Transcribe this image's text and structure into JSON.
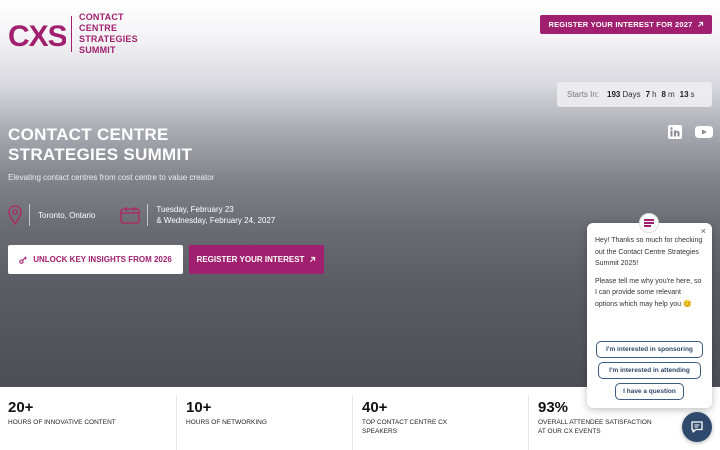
{
  "brand": {
    "logo_mark": "CXS",
    "logo_lines": [
      "CONTACT",
      "CENTRE",
      "STRATEGIES",
      "SUMMIT"
    ],
    "accent": "#a01f6e"
  },
  "header": {
    "cta_label": "REGISTER YOUR INTEREST FOR 2027",
    "cta_icon": "arrow-up-right-icon"
  },
  "countdown": {
    "label": "Starts In:",
    "days": "193",
    "days_unit": "Days",
    "hours": "7",
    "hours_unit": "h",
    "minutes": "8",
    "minutes_unit": "m",
    "seconds": "13",
    "seconds_unit": "s"
  },
  "social": [
    "linkedin-icon",
    "youtube-icon"
  ],
  "hero": {
    "title_line1": "CONTACT CENTRE",
    "title_line2": "STRATEGIES SUMMIT",
    "tagline": "Elevating contact centres from cost centre to value creator",
    "location": "Toronto, Ontario",
    "date_line1": "Tuesday, February 23",
    "date_line2": "& Wednesday, February 24, 2027",
    "btn_insights": "UNLOCK KEY INSIGHTS FROM 2026",
    "btn_register": "REGISTER YOUR INTEREST"
  },
  "stats": [
    {
      "num": "20+",
      "text": "HOURS OF INNOVATIVE CONTENT"
    },
    {
      "num": "10+",
      "text": "HOURS OF NETWORKING"
    },
    {
      "num": "40+",
      "text": "TOP CONTACT CENTRE CX SPEAKERS"
    },
    {
      "num": "93%",
      "text": "OVERALL ATTENDEE SATISFACTION AT OUR CX EVENTS"
    }
  ],
  "chat": {
    "close": "×",
    "msg1": "Hey! Thanks so much for checking out the Contact Centre Strategies Summit 2025!",
    "msg2": "Please tell me why you're here, so I can provide some relevant options which may help you 😊",
    "option1": "I'm interested in sponsoring",
    "option2": "I'm interested in attending",
    "option3": "I have a question"
  }
}
